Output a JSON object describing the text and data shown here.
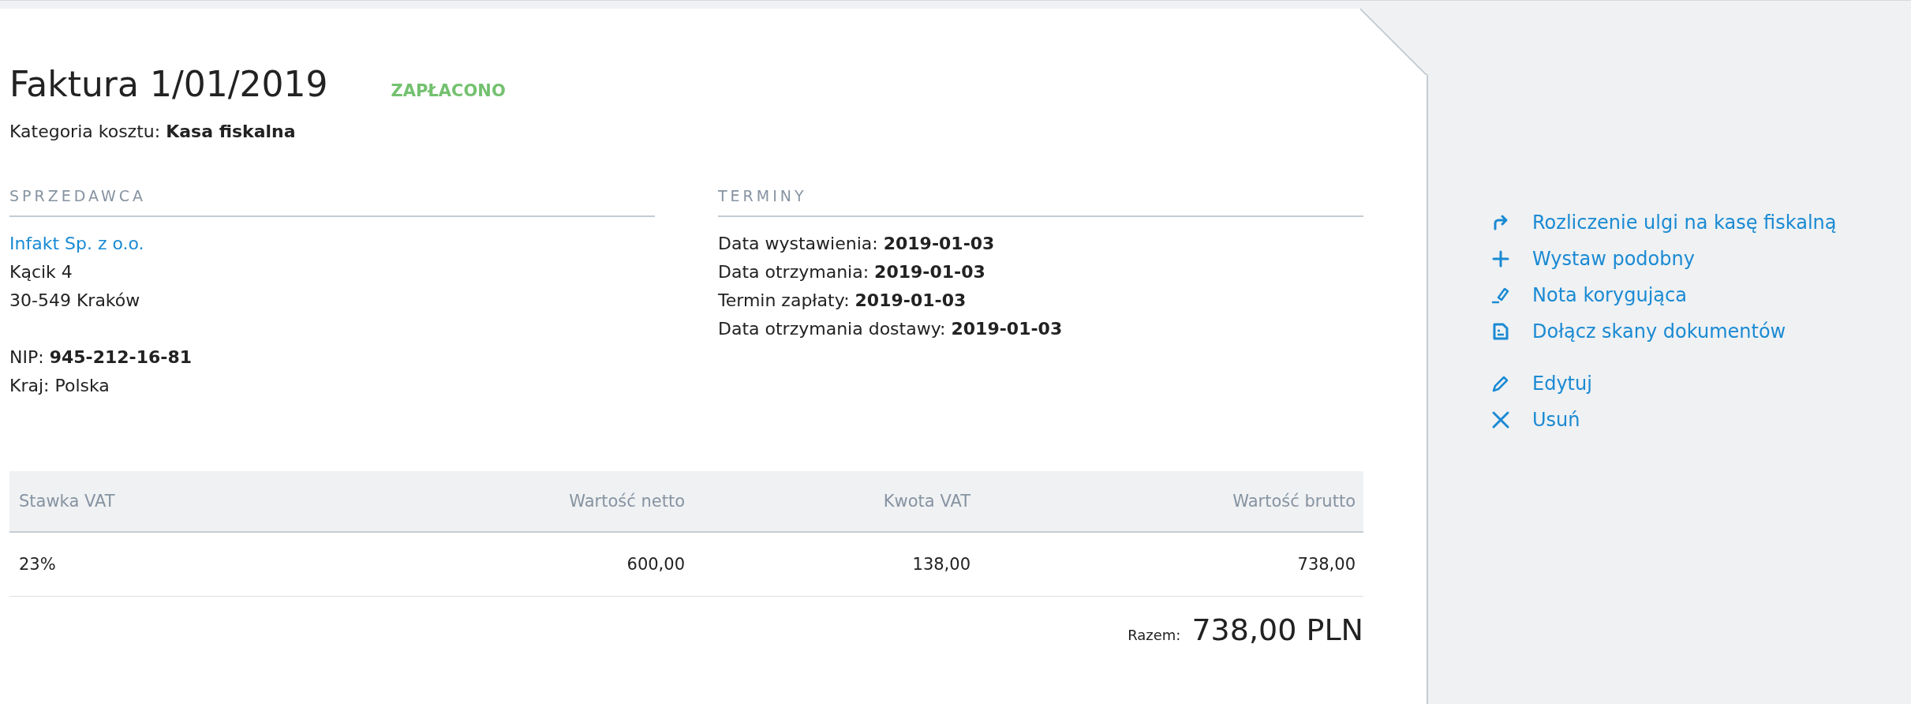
{
  "invoice": {
    "title": "Faktura 1/01/2019",
    "status": {
      "label": "ZAPŁACONO",
      "color": "#74c16f"
    },
    "category_label": "Kategoria kosztu:",
    "category_value": "Kasa fiskalna"
  },
  "seller": {
    "heading": "SPRZEDAWCA",
    "name": "Infakt Sp. z o.o.",
    "address": [
      "Kącik 4",
      "30-549 Kraków"
    ],
    "fields": [
      {
        "label": "NIP:",
        "value": "945-212-16-81",
        "bold": true
      },
      {
        "label": "Kraj:",
        "value": "Polska",
        "bold": false
      }
    ]
  },
  "terms": {
    "heading": "TERMINY",
    "fields": [
      {
        "label": "Data wystawienia:",
        "value": "2019-01-03"
      },
      {
        "label": "Data otrzymania:",
        "value": "2019-01-03"
      },
      {
        "label": "Termin zapłaty:",
        "value": "2019-01-03"
      },
      {
        "label": "Data otrzymania dostawy:",
        "value": "2019-01-03"
      }
    ]
  },
  "table": {
    "columns": [
      "Stawka VAT",
      "Wartość netto",
      "Kwota VAT",
      "Wartość brutto"
    ],
    "rows": [
      [
        "23%",
        "600,00",
        "138,00",
        "738,00"
      ]
    ]
  },
  "total": {
    "label": "Razem:",
    "value": "738,00 PLN"
  },
  "actions": [
    [
      {
        "kind": "redirect",
        "label": "Rozliczenie ulgi na kasę fiskalną"
      },
      {
        "kind": "plus",
        "label": "Wystaw podobny"
      },
      {
        "kind": "note",
        "label": "Nota korygująca"
      },
      {
        "kind": "file",
        "label": "Dołącz skany dokumentów"
      }
    ],
    [
      {
        "kind": "pencil",
        "label": "Edytuj"
      },
      {
        "kind": "cross",
        "label": "Usuń"
      }
    ]
  ]
}
